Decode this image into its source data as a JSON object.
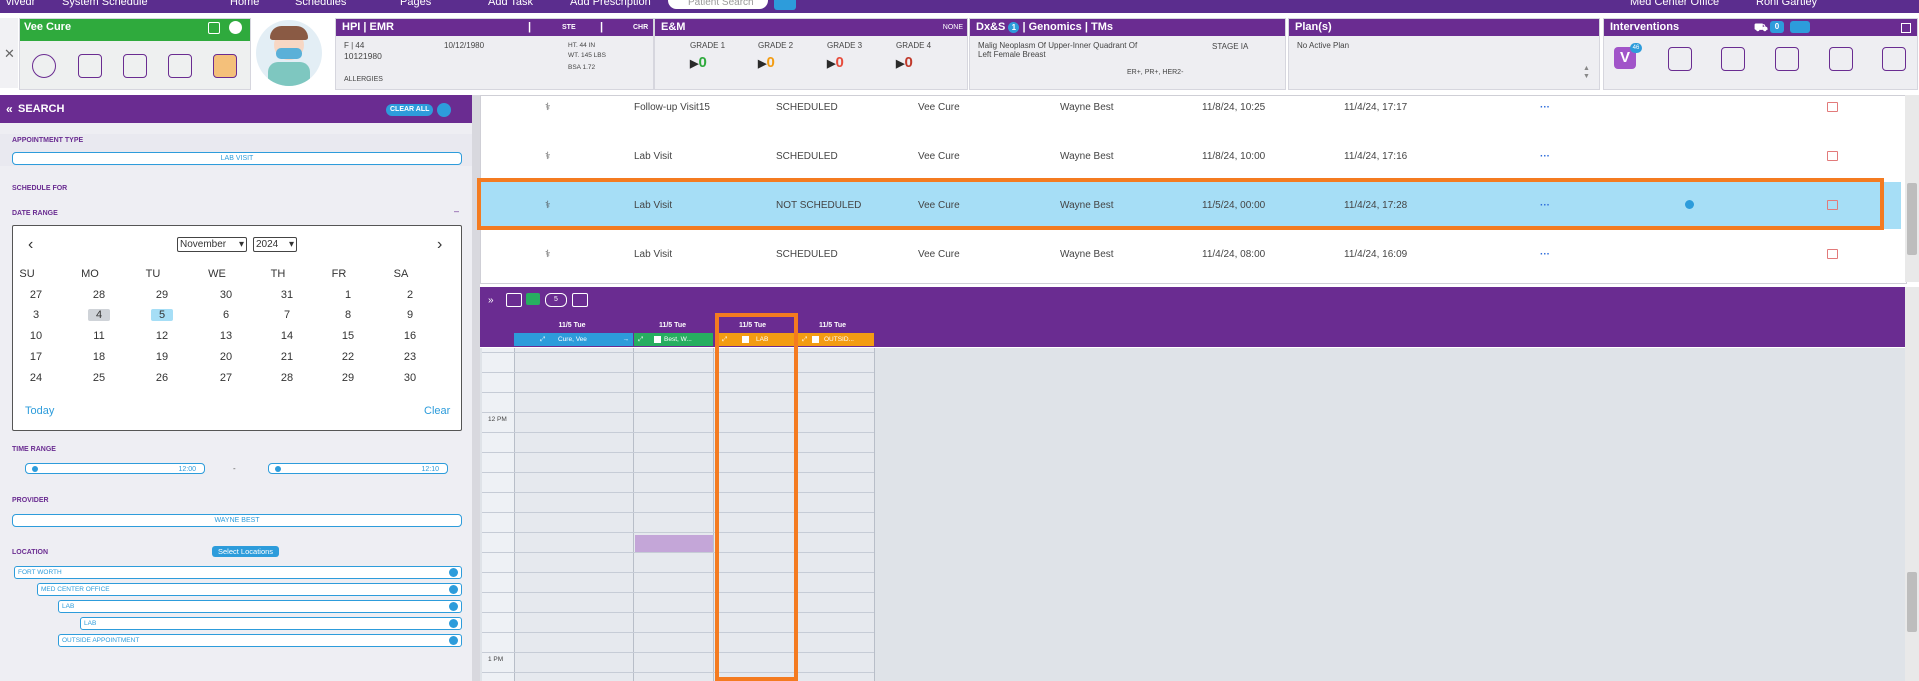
{
  "topbar": {
    "app": "vivedr",
    "page": "System Schedule",
    "nav": [
      "Home",
      "Schedules",
      "Pages",
      "Add Task",
      "Add Prescription"
    ],
    "search_placeholder": "Patient Search",
    "office": "Med Center Office",
    "user": "Roni Gartley"
  },
  "patient_card": {
    "name": "Vee Cure"
  },
  "hpi": {
    "title": "HPI | EMR",
    "ste": "STE",
    "chr": "CHR",
    "sex_age": "F | 44",
    "dob": "10/12/1980",
    "mrn": "10121980",
    "ht": "HT. 44 IN",
    "wt": "WT. 145 LBS",
    "bsa": "BSA 1.72",
    "allergies": "ALLERGIES"
  },
  "em": {
    "title": "E&M",
    "none": "NONE",
    "grades": [
      {
        "label": "GRADE 1",
        "value": "0",
        "color": "#2faa3d"
      },
      {
        "label": "GRADE 2",
        "value": "0",
        "color": "#f39c12"
      },
      {
        "label": "GRADE 3",
        "value": "0",
        "color": "#e74c3c"
      },
      {
        "label": "GRADE 4",
        "value": "0",
        "color": "#c0392b"
      }
    ]
  },
  "dx": {
    "title": "Dx&S",
    "badge": "1",
    "title2": "| Genomics | TMs",
    "diagnosis_line1": "Malig Neoplasm Of Upper-Inner Quadrant Of",
    "diagnosis_line2": "Left Female Breast",
    "stage": "STAGE IA",
    "markers": "ER+, PR+, HER2-"
  },
  "plan": {
    "title": "Plan(s)",
    "text": "No Active Plan"
  },
  "interventions": {
    "title": "Interventions",
    "cart_count": "0",
    "v_badge": "46"
  },
  "search": {
    "title": "SEARCH",
    "clear_all": "CLEAR ALL",
    "appointment_type_label": "APPOINTMENT TYPE",
    "appointment_type_value": "LAB VISIT",
    "schedule_for_label": "SCHEDULE FOR",
    "date_range_label": "DATE RANGE",
    "month": "November",
    "year": "2024",
    "weekdays": [
      "SU",
      "MO",
      "TU",
      "WE",
      "TH",
      "FR",
      "SA"
    ],
    "weeks": [
      [
        "27",
        "28",
        "29",
        "30",
        "31",
        "1",
        "2"
      ],
      [
        "3",
        "4",
        "5",
        "6",
        "7",
        "8",
        "9"
      ],
      [
        "10",
        "11",
        "12",
        "13",
        "14",
        "15",
        "16"
      ],
      [
        "17",
        "18",
        "19",
        "20",
        "21",
        "22",
        "23"
      ],
      [
        "24",
        "25",
        "26",
        "27",
        "28",
        "29",
        "30"
      ]
    ],
    "today_label": "Today",
    "clear_label": "Clear",
    "time_range_label": "TIME RANGE",
    "time_from": "12:00",
    "time_to": "12:10",
    "time_dash": "-",
    "provider_label": "PROVIDER",
    "provider_value": "WAYNE BEST",
    "location_label": "LOCATION",
    "select_locations": "Select Locations",
    "locations": [
      "FORT WORTH",
      "MED CENTER OFFICE",
      "LAB",
      "LAB",
      "OUTSIDE APPOINTMENT"
    ]
  },
  "appointments": [
    {
      "type": "Follow-up Visit15",
      "status": "SCHEDULED",
      "patient": "Vee Cure",
      "provider": "Wayne Best",
      "appt_time": "11/8/24, 10:25",
      "created": "11/4/24, 17:17",
      "more": "···"
    },
    {
      "type": "Lab Visit",
      "status": "SCHEDULED",
      "patient": "Vee Cure",
      "provider": "Wayne Best",
      "appt_time": "11/8/24, 10:00",
      "created": "11/4/24, 17:16",
      "more": "···"
    },
    {
      "type": "Lab Visit",
      "status": "NOT SCHEDULED",
      "patient": "Vee Cure",
      "provider": "Wayne Best",
      "appt_time": "11/5/24, 00:00",
      "created": "11/4/24, 17:28",
      "more": "···"
    },
    {
      "type": "Lab Visit",
      "status": "SCHEDULED",
      "patient": "Vee Cure",
      "provider": "Wayne Best",
      "appt_time": "11/4/24, 08:00",
      "created": "11/4/24, 16:09",
      "more": "···"
    }
  ],
  "scheduler": {
    "toolbar_badge": "5",
    "columns": [
      {
        "date": "11/5 Tue",
        "name": "Cure, Vee",
        "color": "#2d9cdb"
      },
      {
        "date": "11/5 Tue",
        "name": "Best, W...",
        "color": "#27ae60"
      },
      {
        "date": "11/5 Tue",
        "name": "LAB",
        "color": "#f39c12"
      },
      {
        "date": "11/5 Tue",
        "name": "OUTSID...",
        "color": "#f39c12"
      }
    ],
    "time_12pm": "12 PM",
    "time_1pm": "1 PM"
  }
}
